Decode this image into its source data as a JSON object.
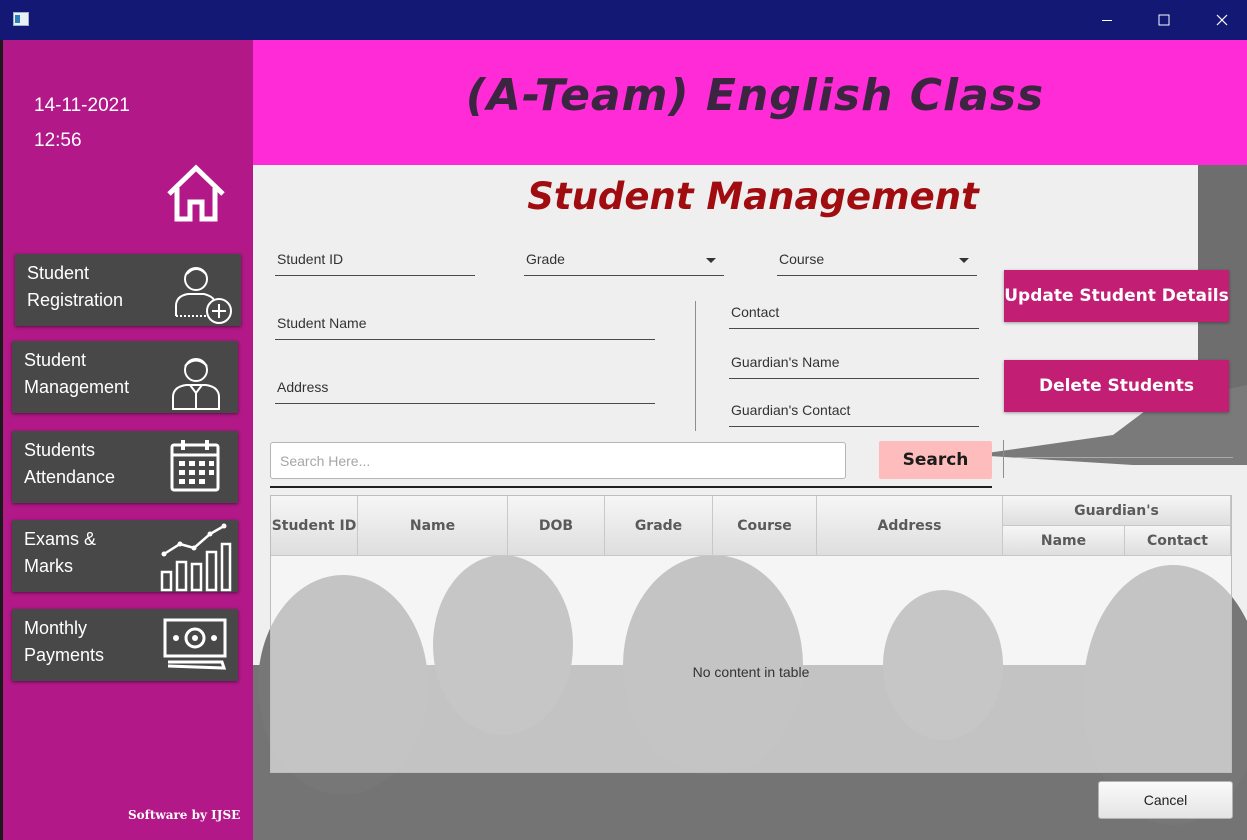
{
  "window": {
    "minimize_icon": "minimize-icon",
    "maximize_icon": "maximize-icon",
    "close_icon": "close-icon"
  },
  "sidebar": {
    "date": "14-11-2021",
    "time": "12:56",
    "home_icon": "home-icon",
    "nav": [
      {
        "label_line1": "Student",
        "label_line2": "Registration",
        "icon": "add-user-icon"
      },
      {
        "label_line1": "Student",
        "label_line2": "Management",
        "icon": "user-icon"
      },
      {
        "label_line1": "Students",
        "label_line2": "Attendance",
        "icon": "calendar-icon"
      },
      {
        "label_line1": "Exams &",
        "label_line2": "Marks",
        "icon": "growth-chart-icon"
      },
      {
        "label_line1": "Monthly",
        "label_line2": "Payments",
        "icon": "money-icon"
      }
    ],
    "credit": "Software by IJSE"
  },
  "header": {
    "title": "(A-Team) English Class"
  },
  "main": {
    "page_title": "Student Management",
    "fields": {
      "student_id": "Student ID",
      "grade": "Grade",
      "course": "Course",
      "student_name": "Student Name",
      "address": "Address",
      "contact": "Contact",
      "guardian_name": "Guardian's Name",
      "guardian_contact": "Guardian's Contact"
    },
    "buttons": {
      "update": "Update Student Details",
      "delete": "Delete Students",
      "search": "Search",
      "cancel": "Cancel"
    },
    "search_placeholder": "Search Here...",
    "table": {
      "columns": [
        "Student ID",
        "Name",
        "DOB",
        "Grade",
        "Course",
        "Address"
      ],
      "group_header": "Guardian's",
      "group_columns": [
        "Name",
        "Contact"
      ],
      "empty_message": "No content in table"
    }
  },
  "colors": {
    "titlebar": "#121873",
    "sidebar": "#b21888",
    "header": "#ff2bd6",
    "page_title": "#a10c10",
    "action_button": "#c21e73",
    "search_button": "#ffbcbc",
    "nav_button": "#484848"
  }
}
